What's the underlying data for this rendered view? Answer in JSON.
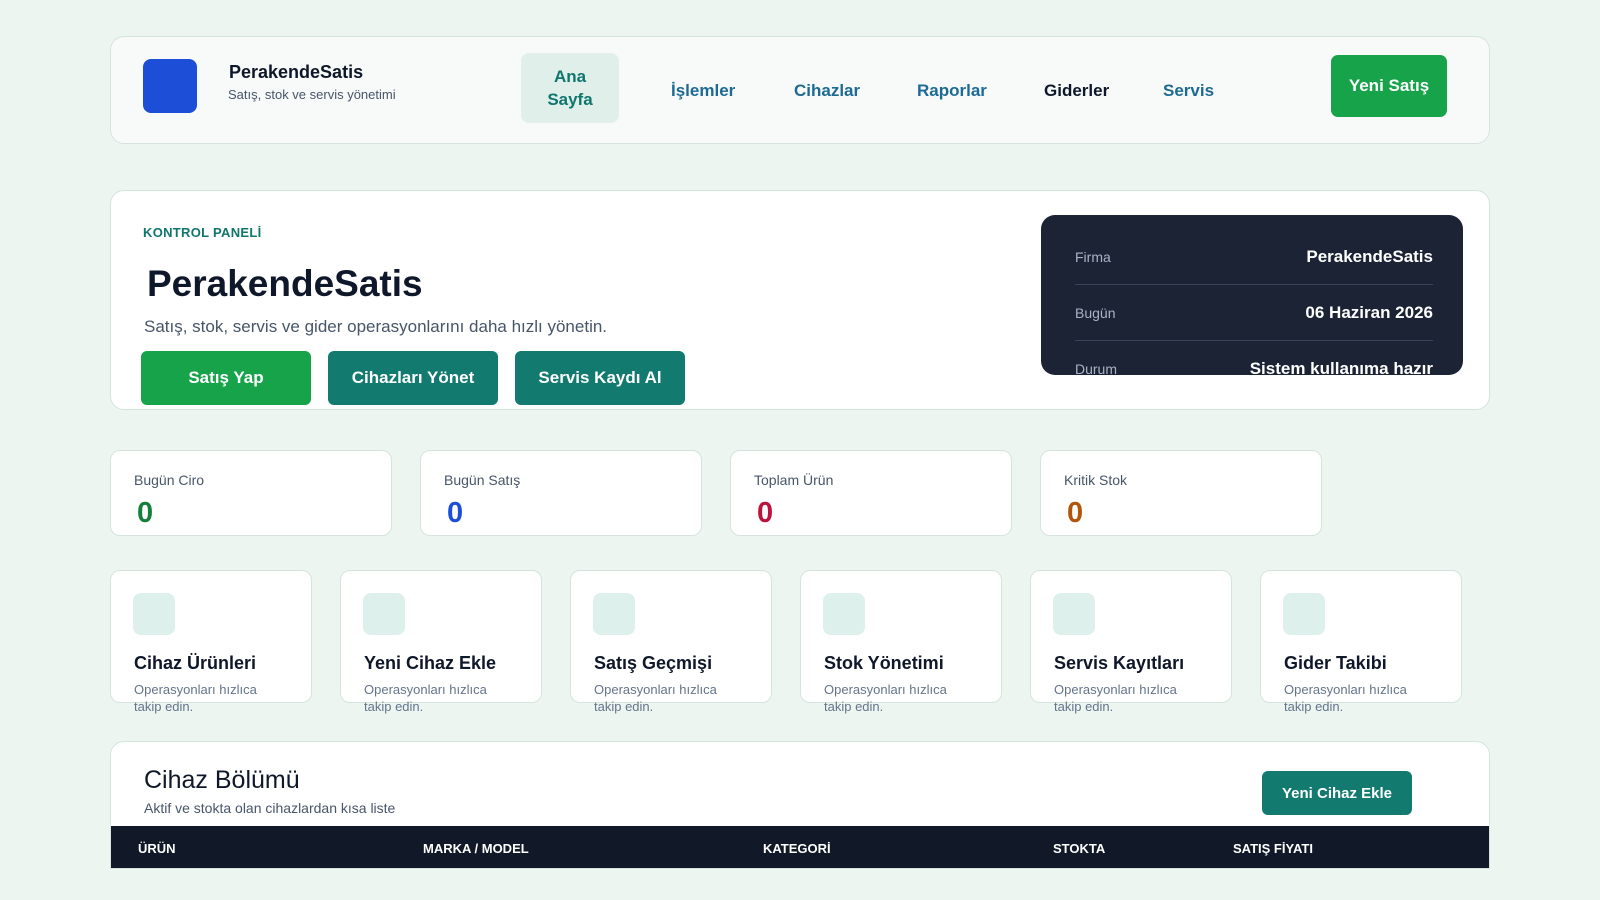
{
  "brand": {
    "name": "PerakendeSatis",
    "subtitle": "Satış, stok ve servis yönetimi"
  },
  "nav": {
    "home": "Ana Sayfa",
    "items": [
      "İşlemler",
      "Cihazlar",
      "Raporlar",
      "Giderler",
      "Servis"
    ],
    "new_sale": "Yeni Satış"
  },
  "hero": {
    "eyebrow": "KONTROL PANELİ",
    "title": "PerakendeSatis",
    "subtitle": "Satış, stok, servis ve gider operasyonlarını daha hızlı yönetin.",
    "buttons": [
      "Satış Yap",
      "Cihazları Yönet",
      "Servis Kaydı Al"
    ]
  },
  "info": {
    "rows": [
      {
        "label": "Firma",
        "value": "PerakendeSatis"
      },
      {
        "label": "Bugün",
        "value": "06 Haziran 2026"
      },
      {
        "label": "Durum",
        "value": "Sistem kullanıma hazır"
      }
    ]
  },
  "stats": [
    {
      "label": "Bugün Ciro",
      "value": "0",
      "color": "#15803d"
    },
    {
      "label": "Bugün Satış",
      "value": "0",
      "color": "#1d4ed8"
    },
    {
      "label": "Toplam Ürün",
      "value": "0",
      "color": "#be123c"
    },
    {
      "label": "Kritik Stok",
      "value": "0",
      "color": "#b45309"
    }
  ],
  "tiles": [
    {
      "title": "Cihaz Ürünleri",
      "desc": "Operasyonları hızlıca takip edin."
    },
    {
      "title": "Yeni Cihaz Ekle",
      "desc": "Operasyonları hızlıca takip edin."
    },
    {
      "title": "Satış Geçmişi",
      "desc": "Operasyonları hızlıca takip edin."
    },
    {
      "title": "Stok Yönetimi",
      "desc": "Operasyonları hızlıca takip edin."
    },
    {
      "title": "Servis Kayıtları",
      "desc": "Operasyonları hızlıca takip edin."
    },
    {
      "title": "Gider Takibi",
      "desc": "Operasyonları hızlıca takip edin."
    }
  ],
  "devices": {
    "title": "Cihaz Bölümü",
    "subtitle": "Aktif ve stokta olan cihazlardan kısa liste",
    "add_button": "Yeni Cihaz Ekle",
    "columns": [
      "ÜRÜN",
      "MARKA / MODEL",
      "KATEGORİ",
      "STOKTA",
      "SATIŞ FİYATI"
    ]
  }
}
